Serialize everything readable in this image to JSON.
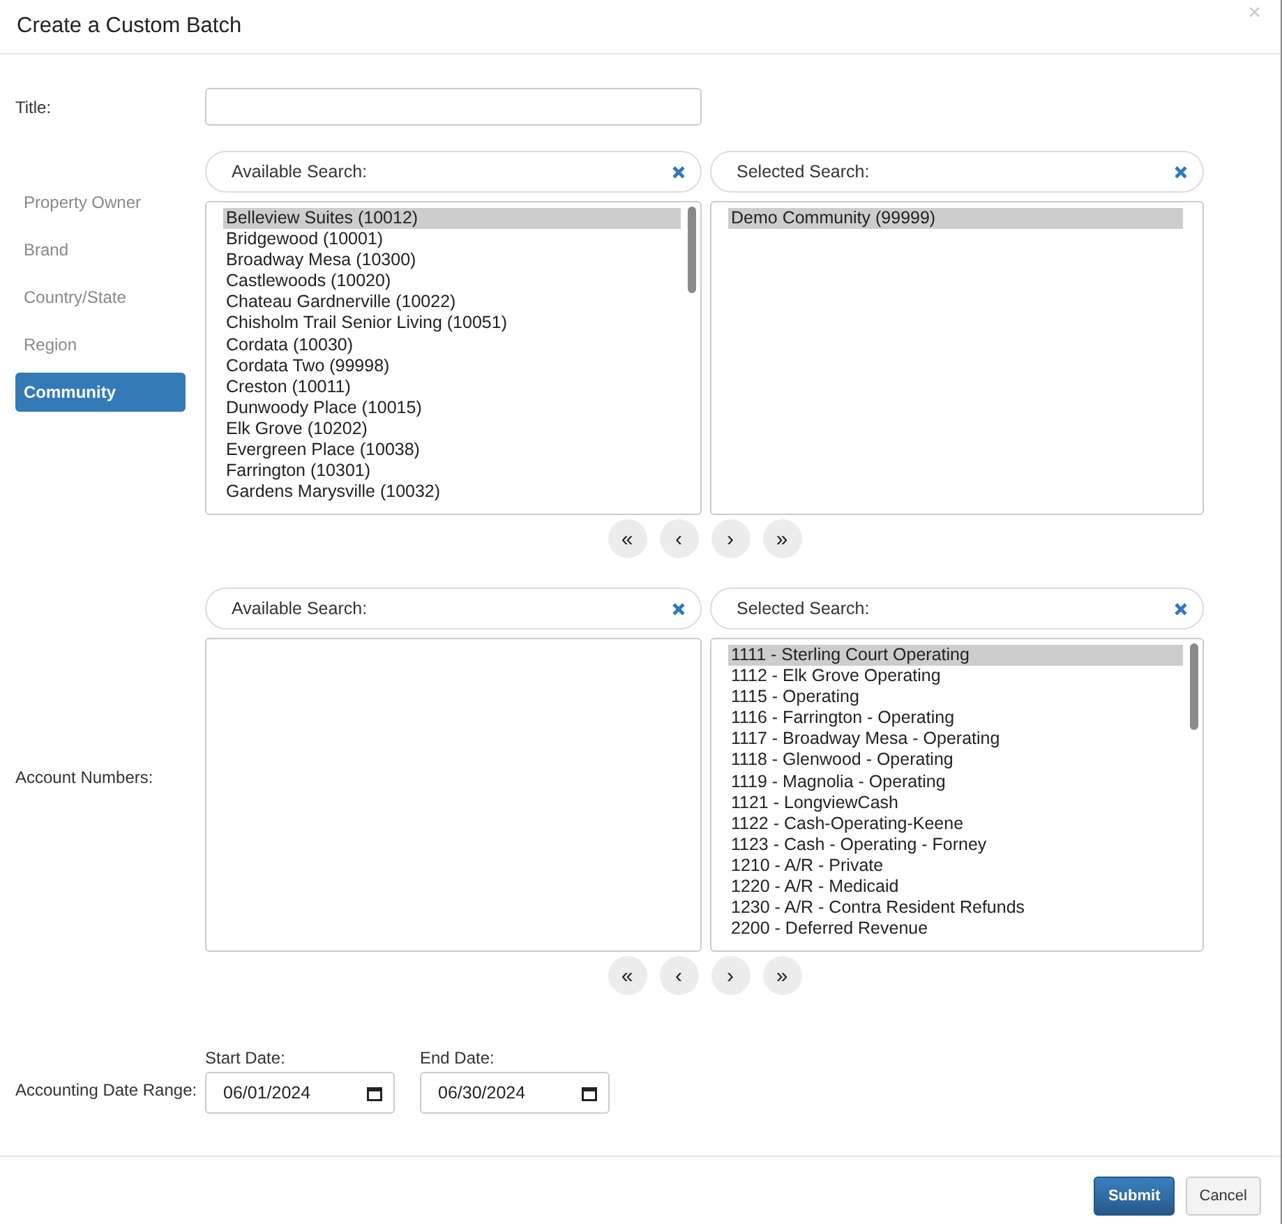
{
  "dialog": {
    "title": "Create a Custom Batch",
    "close": "×"
  },
  "title_field": {
    "label": "Title:"
  },
  "filter_types": [
    {
      "label": "Property Owner",
      "selected": false
    },
    {
      "label": "Brand",
      "selected": false
    },
    {
      "label": "Country/State",
      "selected": false
    },
    {
      "label": "Region",
      "selected": false
    },
    {
      "label": "Community",
      "selected": true
    }
  ],
  "community": {
    "available_search": {
      "placeholder": "Available Search:"
    },
    "selected_search": {
      "placeholder": "Selected Search:"
    },
    "available": [
      {
        "label": "Belleview Suites (10012)",
        "selected": true
      },
      {
        "label": "Bridgewood (10001)",
        "selected": false
      },
      {
        "label": "Broadway Mesa (10300)",
        "selected": false
      },
      {
        "label": "Castlewoods (10020)",
        "selected": false
      },
      {
        "label": "Chateau Gardnerville (10022)",
        "selected": false
      },
      {
        "label": "Chisholm Trail Senior Living (10051)",
        "selected": false
      },
      {
        "label": "Cordata (10030)",
        "selected": false
      },
      {
        "label": "Cordata Two (99998)",
        "selected": false
      },
      {
        "label": "Creston (10011)",
        "selected": false
      },
      {
        "label": "Dunwoody Place (10015)",
        "selected": false
      },
      {
        "label": "Elk Grove (10202)",
        "selected": false
      },
      {
        "label": "Evergreen Place (10038)",
        "selected": false
      },
      {
        "label": "Farrington (10301)",
        "selected": false
      },
      {
        "label": "Gardens Marysville (10032)",
        "selected": false
      }
    ],
    "selected": [
      {
        "label": "Demo Community (99999)",
        "selected": true
      }
    ],
    "move_buttons": [
      "«",
      "‹",
      "›",
      "»"
    ]
  },
  "accounts": {
    "label": "Account Numbers:",
    "available_search": {
      "placeholder": "Available Search:"
    },
    "selected_search": {
      "placeholder": "Selected Search:"
    },
    "selected": [
      {
        "label": "1111 - Sterling Court Operating",
        "selected": true
      },
      {
        "label": "1112 - Elk Grove Operating",
        "selected": false
      },
      {
        "label": "1115 - Operating",
        "selected": false
      },
      {
        "label": "1116 - Farrington - Operating",
        "selected": false
      },
      {
        "label": "1117 - Broadway Mesa - Operating",
        "selected": false
      },
      {
        "label": "1118 - Glenwood - Operating",
        "selected": false
      },
      {
        "label": "1119 - Magnolia - Operating",
        "selected": false
      },
      {
        "label": "1121 - LongviewCash",
        "selected": false
      },
      {
        "label": "1122 - Cash-Operating-Keene",
        "selected": false
      },
      {
        "label": "1123 - Cash - Operating - Forney",
        "selected": false
      },
      {
        "label": "1210 - A/R - Private",
        "selected": false
      },
      {
        "label": "1220 - A/R - Medicaid",
        "selected": false
      },
      {
        "label": "1230 - A/R - Contra Resident Refunds",
        "selected": false
      },
      {
        "label": "2200 - Deferred Revenue",
        "selected": false
      }
    ],
    "move_buttons": [
      "«",
      "‹",
      "›",
      "»"
    ]
  },
  "date_range": {
    "label": "Accounting Date Range:",
    "start": {
      "label": "Start Date:",
      "value": "06/01/2024"
    },
    "end": {
      "label": "End Date:",
      "value": "06/30/2024"
    }
  },
  "buttons": [
    {
      "label": "Submit",
      "kind": "primary"
    },
    {
      "label": "Cancel",
      "kind": "secondary"
    }
  ]
}
